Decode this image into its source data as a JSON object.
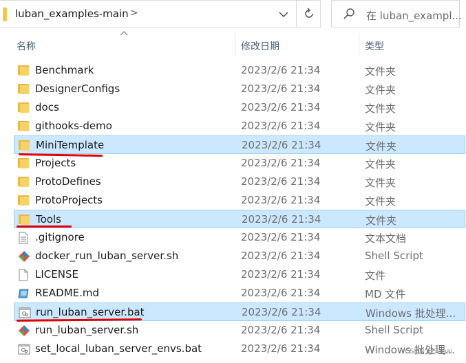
{
  "address_bar": {
    "path": "luban_examples-main",
    "separator": ">"
  },
  "search": {
    "placeholder": "在 luban_exampl..."
  },
  "columns": {
    "name": "名称",
    "modified": "修改日期",
    "type": "类型"
  },
  "files": [
    {
      "name": "Benchmark",
      "modified": "2023/2/6 21:34",
      "type": "文件夹",
      "icon": "folder-icon",
      "selected": false
    },
    {
      "name": "DesignerConfigs",
      "modified": "2023/2/6 21:34",
      "type": "文件夹",
      "icon": "folder-icon",
      "selected": false
    },
    {
      "name": "docs",
      "modified": "2023/2/6 21:34",
      "type": "文件夹",
      "icon": "folder-icon",
      "selected": false
    },
    {
      "name": "githooks-demo",
      "modified": "2023/2/6 21:34",
      "type": "文件夹",
      "icon": "folder-icon",
      "selected": false
    },
    {
      "name": "MiniTemplate",
      "modified": "2023/2/6 21:34",
      "type": "文件夹",
      "icon": "folder-icon",
      "selected": true
    },
    {
      "name": "Projects",
      "modified": "2023/2/6 21:34",
      "type": "文件夹",
      "icon": "folder-icon",
      "selected": false
    },
    {
      "name": "ProtoDefines",
      "modified": "2023/2/6 21:34",
      "type": "文件夹",
      "icon": "folder-icon",
      "selected": false
    },
    {
      "name": "ProtoProjects",
      "modified": "2023/2/6 21:34",
      "type": "文件夹",
      "icon": "folder-icon",
      "selected": false
    },
    {
      "name": "Tools",
      "modified": "2023/2/6 21:34",
      "type": "文件夹",
      "icon": "folder-icon",
      "selected": true
    },
    {
      "name": ".gitignore",
      "modified": "2023/2/6 21:34",
      "type": "文本文档",
      "icon": "text-file-icon",
      "selected": false
    },
    {
      "name": "docker_run_luban_server.sh",
      "modified": "2023/2/6 21:34",
      "type": "Shell Script",
      "icon": "shell-script-icon",
      "selected": false
    },
    {
      "name": "LICENSE",
      "modified": "2023/2/6 21:34",
      "type": "文件",
      "icon": "blank-file-icon",
      "selected": false
    },
    {
      "name": "README.md",
      "modified": "2023/2/6 21:34",
      "type": "MD 文件",
      "icon": "markdown-file-icon",
      "selected": false
    },
    {
      "name": "run_luban_server.bat",
      "modified": "2023/2/6 21:34",
      "type": "Windows 批处理...",
      "icon": "batch-file-icon",
      "selected": true
    },
    {
      "name": "run_luban_server.sh",
      "modified": "2023/2/6 21:34",
      "type": "Shell Script",
      "icon": "shell-script-icon",
      "selected": false
    },
    {
      "name": "set_local_luban_server_envs.bat",
      "modified": "2023/2/6 21:34",
      "type": "Windows 批处理...",
      "icon": "batch-file-icon",
      "selected": false
    }
  ],
  "colors": {
    "selection_bg": "#cce8ff",
    "selection_border": "#99d1ff",
    "annotation_red": "#e10000",
    "folder_yellow": "#f7d266"
  },
  "watermark": "CSDN @Sagai"
}
